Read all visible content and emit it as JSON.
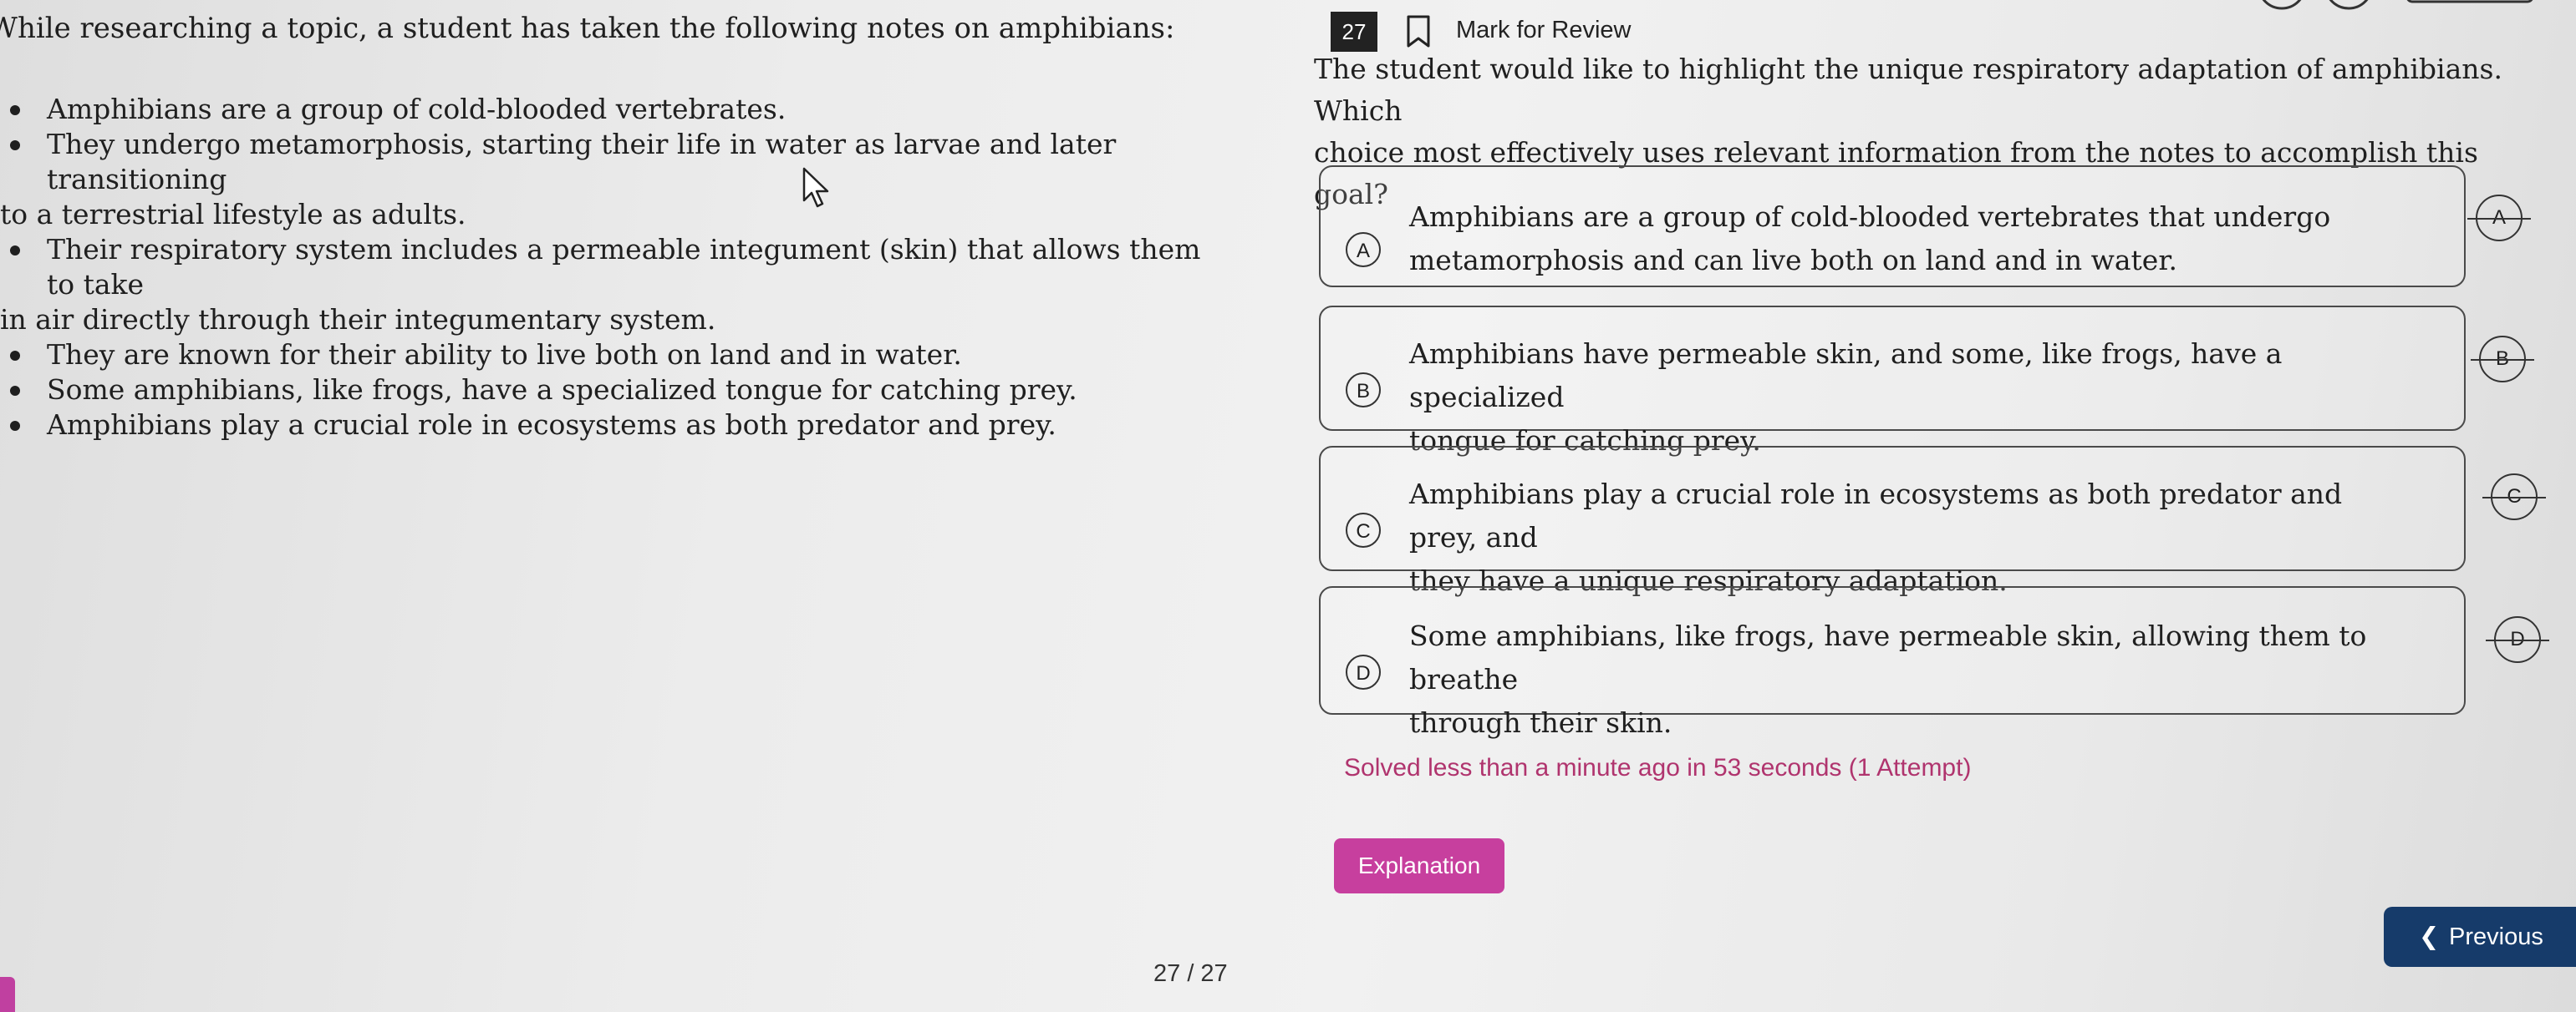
{
  "passage": {
    "intro": "While researching a topic, a student has taken the following notes on amphibians:",
    "notes": [
      "Amphibians are a group of cold-blooded vertebrates.",
      "They undergo metamorphosis, starting their life in water as larvae and later transitioning",
      "to a terrestrial lifestyle as adults.",
      "Their respiratory system includes a permeable integument (skin) that allows them to take",
      "in air directly through their integumentary system.",
      "They are known for their ability to live both on land and in water.",
      "Some amphibians, like frogs, have a specialized tongue for catching prey.",
      "Amphibians play a crucial role in ecosystems as both predator and prey."
    ]
  },
  "header": {
    "question_number": "27",
    "mark_for_review": "Mark for Review",
    "bookmark_icon": "bookmark-icon"
  },
  "question": {
    "text_line1": "The student would like to highlight the unique respiratory adaptation of amphibians. Which",
    "text_line2": "choice most effectively uses relevant information from the notes to accomplish this goal?"
  },
  "choices": [
    {
      "letter": "A",
      "line1": "Amphibians are a group of cold-blooded vertebrates that undergo",
      "line2": "metamorphosis and can live both on land and in water."
    },
    {
      "letter": "B",
      "line1": "Amphibians have permeable skin, and some, like frogs, have a specialized",
      "line2": "tongue for catching prey."
    },
    {
      "letter": "C",
      "line1": "Amphibians play a crucial role in ecosystems as both predator and prey, and",
      "line2": "they have a unique respiratory adaptation."
    },
    {
      "letter": "D",
      "line1": "Some amphibians, like frogs, have permeable skin, allowing them to breathe",
      "line2": "through their skin."
    }
  ],
  "status": {
    "solved_text": "Solved less than a minute ago in 53 seconds (1 Attempt)"
  },
  "buttons": {
    "explanation": "Explanation",
    "previous": "Previous",
    "previous_icon": "chevron-left-icon"
  },
  "footer": {
    "page_counter": "27 / 27"
  },
  "colors": {
    "question_badge": "#222222",
    "solved_text": "#b0346e",
    "explanation_button": "#c73f9e",
    "previous_button": "#163b6a"
  }
}
